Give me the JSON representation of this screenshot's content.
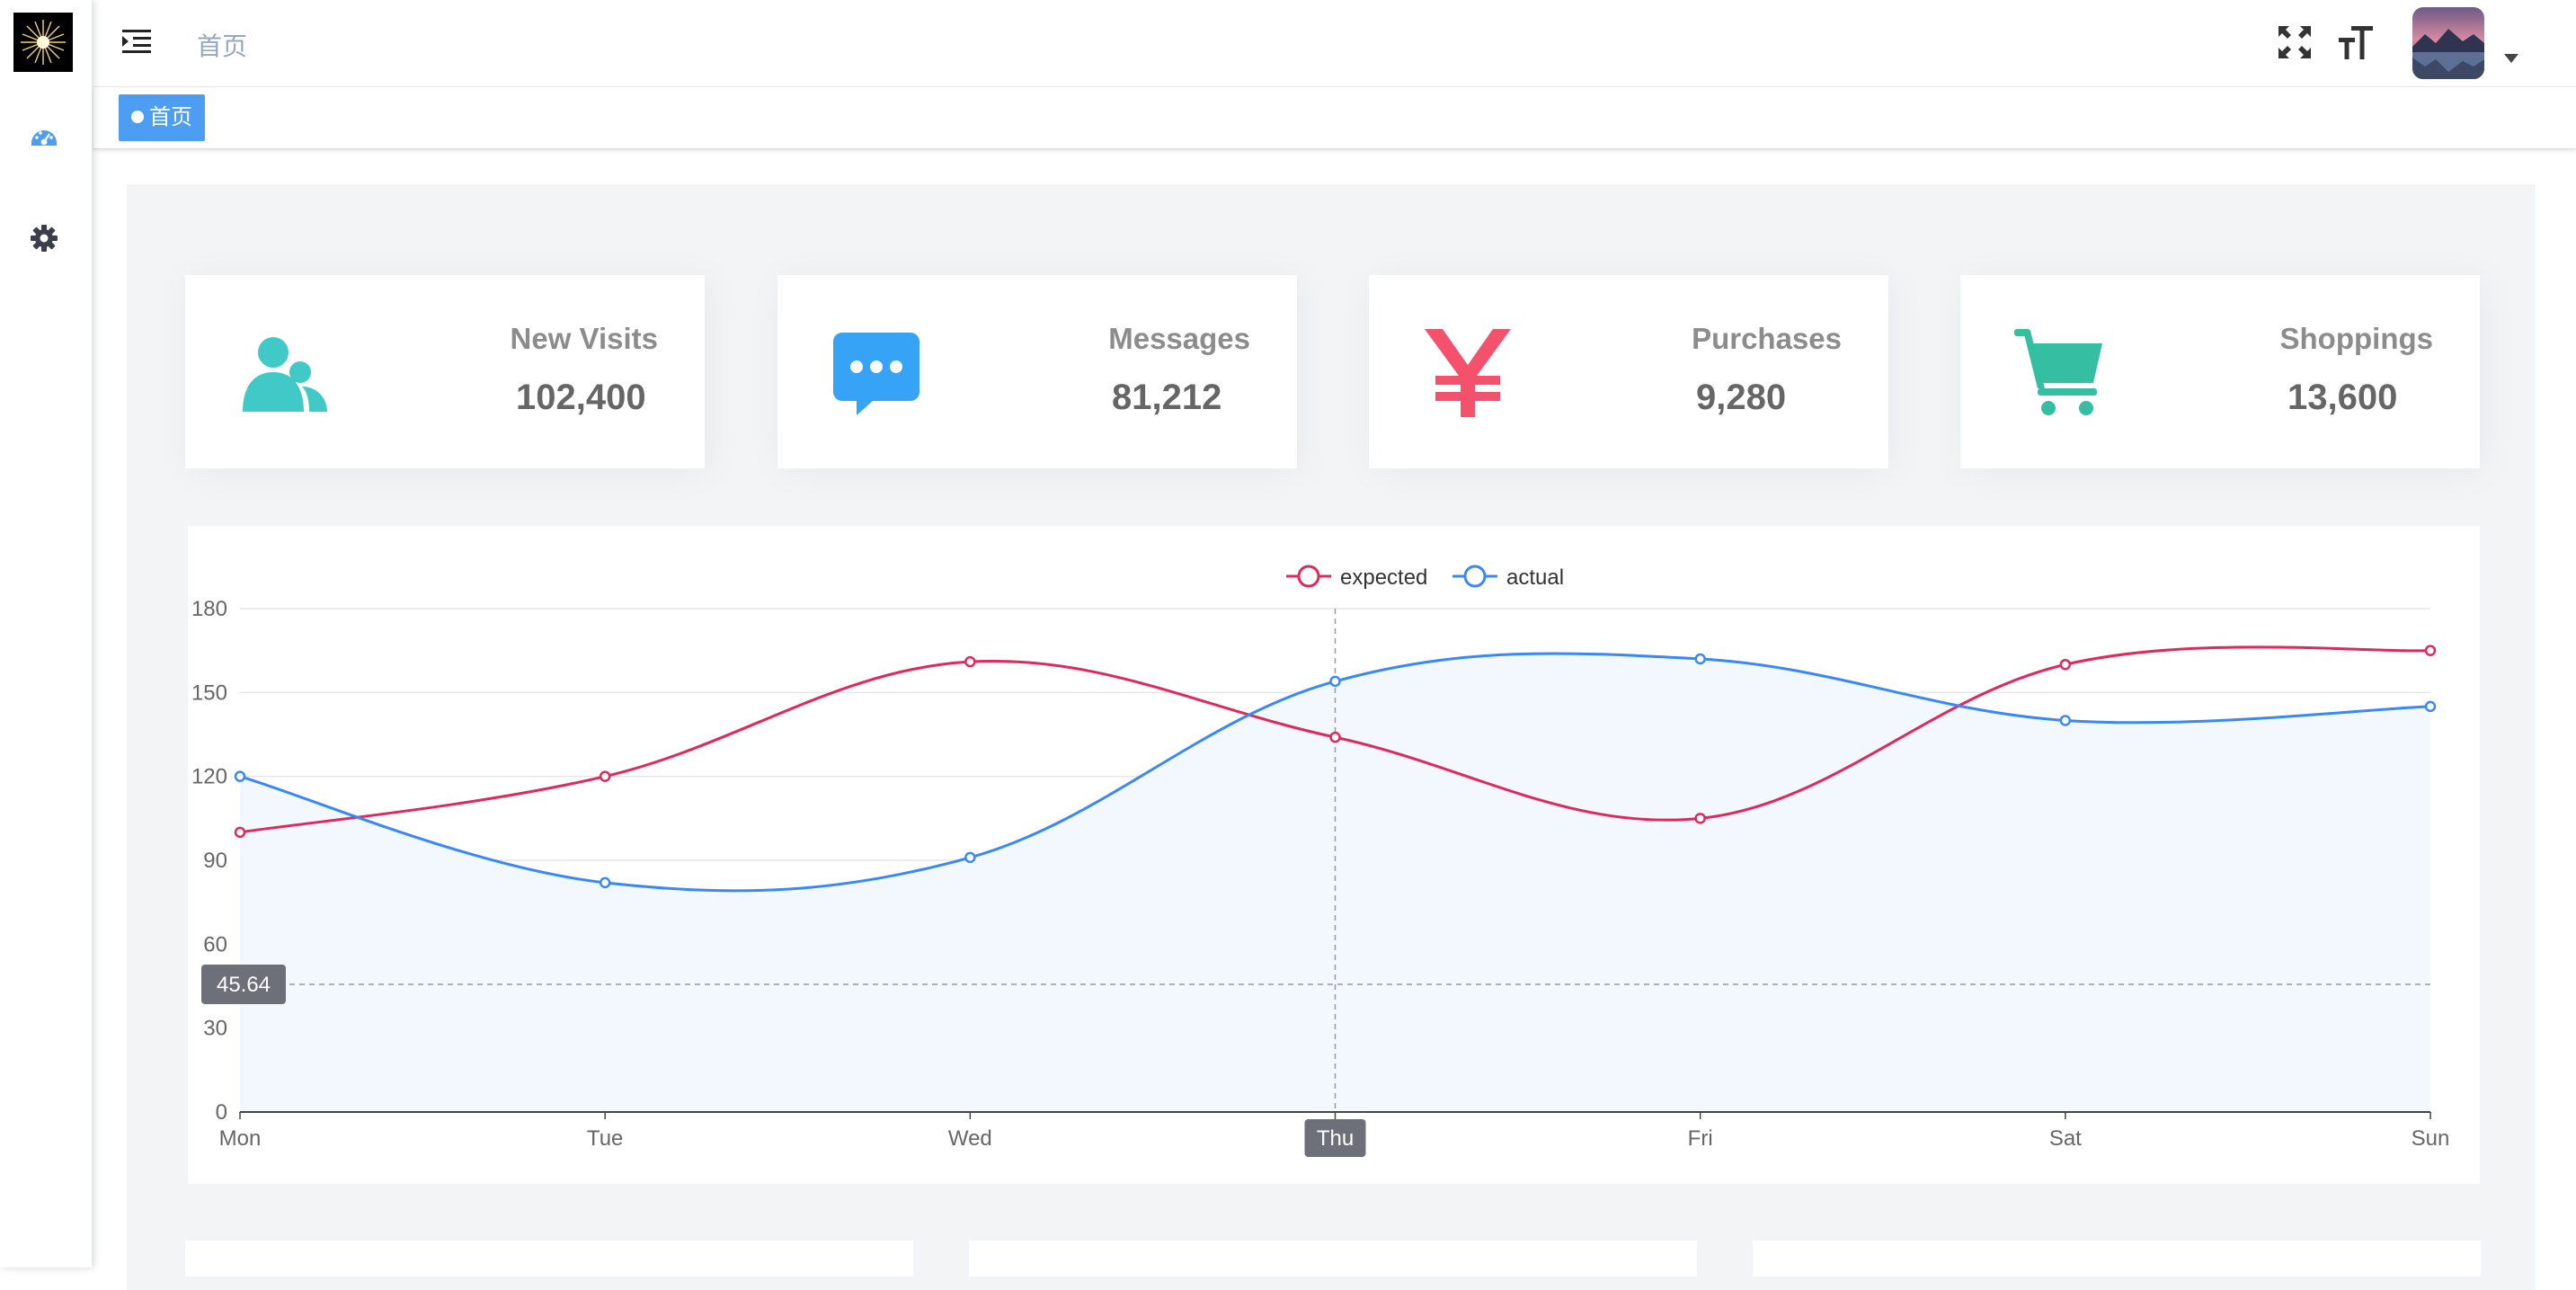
{
  "breadcrumb": {
    "current": "首页"
  },
  "tags": [
    {
      "label": "首页"
    }
  ],
  "sidebar": {
    "items": [
      {
        "icon": "dashboard-icon"
      },
      {
        "icon": "gear-icon"
      }
    ]
  },
  "navbar": {
    "icons": [
      "hamburger-icon",
      "fullscreen-icon",
      "font-size-icon"
    ]
  },
  "colors": {
    "accent": "#4d9ef2",
    "visits": "#40c9c6",
    "messages": "#36a3f7",
    "purchases": "#f4516c",
    "shoppings": "#34bfa3",
    "expected": "#e0285a",
    "actual": "#3888fa"
  },
  "cards": [
    {
      "title": "New Visits",
      "value": "102,400",
      "icon": "peoples-icon"
    },
    {
      "title": "Messages",
      "value": "81,212",
      "icon": "message-icon"
    },
    {
      "title": "Purchases",
      "value": "9,280",
      "icon": "money-icon"
    },
    {
      "title": "Shoppings",
      "value": "13,600",
      "icon": "shopping-cart-icon"
    }
  ],
  "chart_data": {
    "type": "line",
    "categories": [
      "Mon",
      "Tue",
      "Wed",
      "Thu",
      "Fri",
      "Sat",
      "Sun"
    ],
    "series": [
      {
        "name": "expected",
        "values": [
          100,
          120,
          161,
          134,
          105,
          160,
          165
        ]
      },
      {
        "name": "actual",
        "values": [
          120,
          82,
          91,
          154,
          162,
          140,
          145
        ]
      }
    ],
    "yticks": [
      0,
      30,
      60,
      90,
      120,
      150,
      180
    ],
    "ylim": [
      0,
      180
    ],
    "legend_position": "top-center",
    "grid": true,
    "tooltip": {
      "x_label": "Thu",
      "y_label": "45.64"
    }
  }
}
